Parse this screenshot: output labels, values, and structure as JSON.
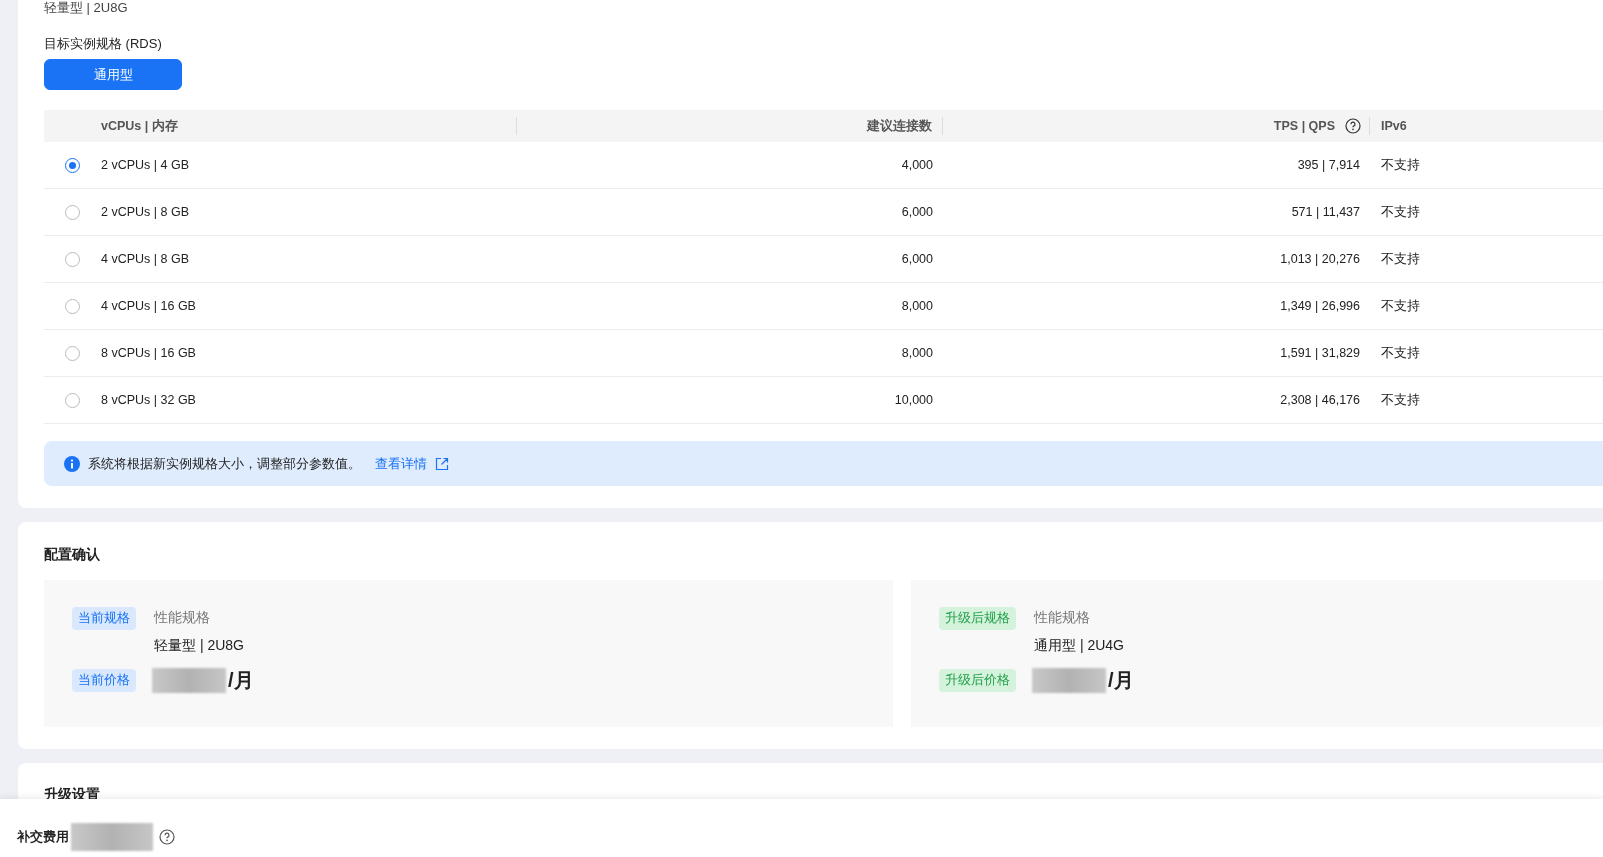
{
  "top_card": {
    "current_spec": "轻量型 | 2U8G",
    "target_label": "目标实例规格 (RDS)",
    "types": [
      {
        "label": "通用型",
        "selected": true
      }
    ]
  },
  "spec_table": {
    "columns": [
      "vCPUs | 内存",
      "建议连接数",
      "TPS | QPS",
      "IPv6"
    ],
    "rows": [
      {
        "selected": true,
        "spec": "2 vCPUs | 4 GB",
        "connections": "4,000",
        "tps_qps": "395 | 7,914",
        "ipv6": "不支持"
      },
      {
        "selected": false,
        "spec": "2 vCPUs | 8 GB",
        "connections": "6,000",
        "tps_qps": "571 | 11,437",
        "ipv6": "不支持"
      },
      {
        "selected": false,
        "spec": "4 vCPUs | 8 GB",
        "connections": "6,000",
        "tps_qps": "1,013 | 20,276",
        "ipv6": "不支持"
      },
      {
        "selected": false,
        "spec": "4 vCPUs | 16 GB",
        "connections": "8,000",
        "tps_qps": "1,349 | 26,996",
        "ipv6": "不支持"
      },
      {
        "selected": false,
        "spec": "8 vCPUs | 16 GB",
        "connections": "8,000",
        "tps_qps": "1,591 | 31,829",
        "ipv6": "不支持"
      },
      {
        "selected": false,
        "spec": "8 vCPUs | 32 GB",
        "connections": "10,000",
        "tps_qps": "2,308 | 46,176",
        "ipv6": "不支持"
      }
    ]
  },
  "notice": {
    "text": "系统将根据新实例规格大小，调整部分参数值。",
    "link": "查看详情"
  },
  "confirm": {
    "title": "配置确认",
    "panels": [
      {
        "kind": "current",
        "spec_tag": "当前规格",
        "spec_label": "性能规格",
        "spec_value": "轻量型 | 2U8G",
        "price_tag": "当前价格",
        "price_unit": "/月"
      },
      {
        "kind": "upgraded",
        "spec_tag": "升级后规格",
        "spec_label": "性能规格",
        "spec_value": "通用型 | 2U4G",
        "price_tag": "升级后价格",
        "price_unit": "/月"
      }
    ]
  },
  "upgrade_settings": {
    "title": "升级设置"
  },
  "footer": {
    "label": "补交费用"
  }
}
